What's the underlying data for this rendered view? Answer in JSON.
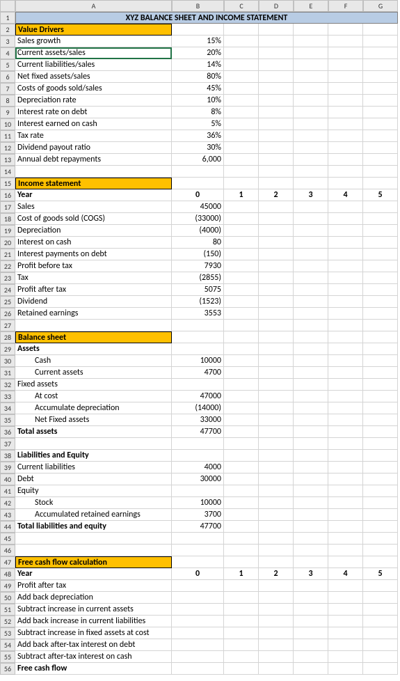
{
  "columns": [
    "A",
    "B",
    "C",
    "D",
    "E",
    "F",
    "G"
  ],
  "colWidths": {
    "A": 225,
    "B": 75,
    "C": 50,
    "D": 50,
    "E": 50,
    "F": 50,
    "G": 50
  },
  "title": "XYZ BALANCE SHEET AND INCOME STATEMENT",
  "sections": {
    "value_drivers": "Value Drivers",
    "income_statement": "Income statement",
    "balance_sheet": "Balance sheet",
    "free_cash_flow": "Free cash flow calculation"
  },
  "rows": {
    "r3": {
      "label": "Sales growth",
      "val": "15%"
    },
    "r4": {
      "label": "Current assets/sales",
      "val": "20%"
    },
    "r5": {
      "label": "Current liabilities/sales",
      "val": "14%"
    },
    "r6": {
      "label": "Net fixed assets/sales",
      "val": "80%"
    },
    "r7": {
      "label": "Costs of goods sold/sales",
      "val": "45%"
    },
    "r8": {
      "label": "Depreciation rate",
      "val": "10%"
    },
    "r9": {
      "label": "Interest rate on debt",
      "val": "8%"
    },
    "r10": {
      "label": "Interest earned on cash",
      "val": "5%"
    },
    "r11": {
      "label": "Tax rate",
      "val": "36%"
    },
    "r12": {
      "label": "Dividend payout ratio",
      "val": "30%"
    },
    "r13": {
      "label": "Annual debt repayments",
      "val": "6,000"
    },
    "r16": {
      "label": "Year",
      "y0": "0",
      "y1": "1",
      "y2": "2",
      "y3": "3",
      "y4": "4",
      "y5": "5"
    },
    "r17": {
      "label": "Sales",
      "val": "45000"
    },
    "r18": {
      "label": "Cost of goods sold (COGS)",
      "val": "(33000)"
    },
    "r19": {
      "label": "Depreciation",
      "val": "(4000)"
    },
    "r20": {
      "label": "Interest on cash",
      "val": "80"
    },
    "r21": {
      "label": "Interest payments on debt",
      "val": "(150)"
    },
    "r22": {
      "label": "Profit before tax",
      "val": "7930"
    },
    "r23": {
      "label": "Tax",
      "val": "(2855)"
    },
    "r24": {
      "label": "Profit after tax",
      "val": "5075"
    },
    "r25": {
      "label": "Dividend",
      "val": "(1523)"
    },
    "r26": {
      "label": "Retained earnings",
      "val": "3553"
    },
    "r29": {
      "label": "Assets"
    },
    "r30": {
      "label": "Cash",
      "val": "10000"
    },
    "r31": {
      "label": "Current assets",
      "val": "4700"
    },
    "r32": {
      "label": "Fixed assets"
    },
    "r33": {
      "label": "At cost",
      "val": "47000"
    },
    "r34": {
      "label": "Accumulate depreciation",
      "val": "(14000)"
    },
    "r35": {
      "label": "Net Fixed assets",
      "val": "33000"
    },
    "r36": {
      "label": "Total assets",
      "val": "47700"
    },
    "r38": {
      "label": "Liabilities and Equity"
    },
    "r39": {
      "label": "Current liabilities",
      "val": "4000"
    },
    "r40": {
      "label": "Debt",
      "val": "30000"
    },
    "r41": {
      "label": "Equity"
    },
    "r42": {
      "label": "Stock",
      "val": "10000"
    },
    "r43": {
      "label": "Accumulated retained earnings",
      "val": "3700"
    },
    "r44": {
      "label": "Total liabilities and equity",
      "val": "47700"
    },
    "r48": {
      "label": "Year",
      "y0": "0",
      "y1": "1",
      "y2": "2",
      "y3": "3",
      "y4": "4",
      "y5": "5"
    },
    "r49": {
      "label": "Profit after tax"
    },
    "r50": {
      "label": "Add back depreciation"
    },
    "r51": {
      "label": "Subtract increase in current assets"
    },
    "r52": {
      "label": "Add back increase in current liabilities"
    },
    "r53": {
      "label": "Subtract increase in fixed assets at cost"
    },
    "r54": {
      "label": "Add back after-tax interest on debt"
    },
    "r55": {
      "label": "Subtract after-tax interest on cash"
    },
    "r56": {
      "label": "Free cash flow"
    }
  }
}
